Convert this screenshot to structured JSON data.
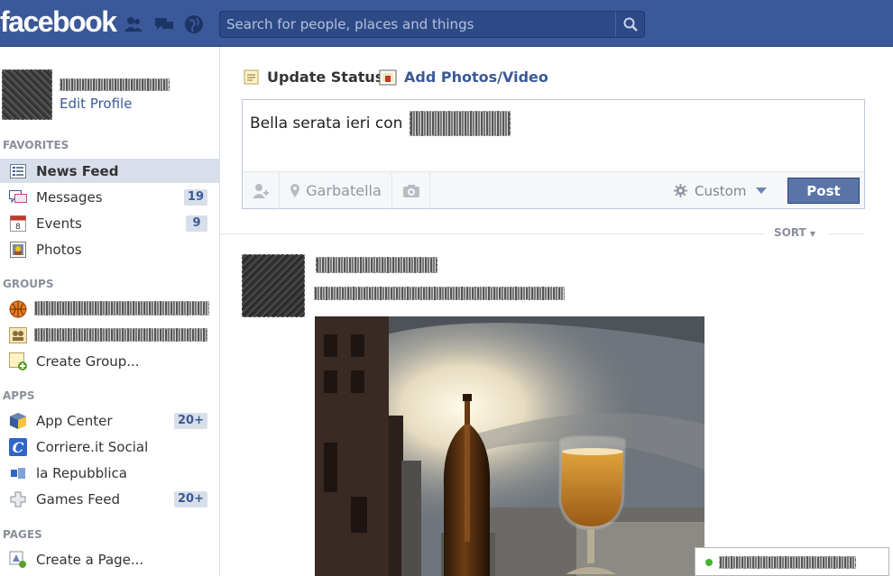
{
  "topbar": {
    "logo": "facebook",
    "search_placeholder": "Search for people, places and things"
  },
  "sidebar": {
    "edit_profile": "Edit Profile",
    "favorites_title": "FAVORITES",
    "favorites": [
      {
        "label": "News Feed",
        "count": ""
      },
      {
        "label": "Messages",
        "count": "19"
      },
      {
        "label": "Events",
        "count": "9"
      },
      {
        "label": "Photos",
        "count": ""
      }
    ],
    "groups_title": "GROUPS",
    "create_group": "Create Group...",
    "apps_title": "APPS",
    "apps": [
      {
        "label": "App Center",
        "count": "20+"
      },
      {
        "label": "Corriere.it Social",
        "count": ""
      },
      {
        "label": "la Repubblica",
        "count": ""
      },
      {
        "label": "Games Feed",
        "count": "20+"
      }
    ],
    "pages_title": "PAGES",
    "create_page": "Create a Page..."
  },
  "composer": {
    "tab_update_status": "Update Status",
    "tab_add_photos": "Add Photos/Video",
    "text": "Bella serata ieri con",
    "location": "Garbatella",
    "audience": "Custom",
    "post_label": "Post"
  },
  "feed": {
    "sort_label": "SORT"
  },
  "colors": {
    "brand": "#3b5998",
    "post_button": "#5b74a8",
    "online": "#42b72a"
  }
}
